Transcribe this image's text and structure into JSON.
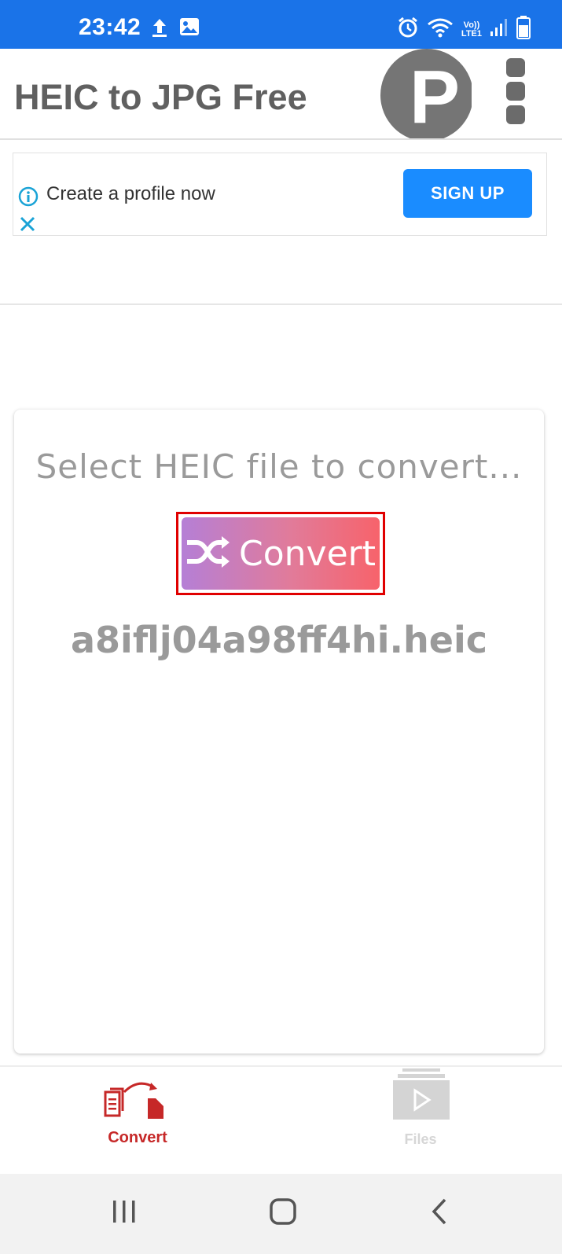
{
  "status_bar": {
    "time": "23:42",
    "left_icons": [
      "upload-icon",
      "image-icon"
    ],
    "right_icons": [
      "alarm-icon",
      "wifi-icon",
      "volte-icon",
      "signal-icon",
      "battery-icon"
    ],
    "network_label_top": "Vo))",
    "network_label_bottom": "LTE1",
    "background": "#1a73e8"
  },
  "app_bar": {
    "title": "HEIC to JPG Free",
    "profile_initial": "P",
    "menu_icon": "more-vert-icon"
  },
  "ad_banner": {
    "text": "Create a profile now",
    "button_label": "SIGN UP",
    "button_color": "#1a8cff"
  },
  "card": {
    "prompt": "Select HEIC file to convert...",
    "convert_label": "Convert",
    "convert_icon": "shuffle-icon",
    "file_name": "a8iflj04a98ff4hi.heic",
    "highlight_color": "#e00000"
  },
  "bottom_nav": {
    "items": [
      {
        "label": "Convert",
        "icon": "convert-files-icon",
        "active": true,
        "color": "#c62828"
      },
      {
        "label": "Files",
        "icon": "files-play-icon",
        "active": false,
        "color": "#d0d0d0"
      }
    ]
  },
  "system_nav": {
    "buttons": [
      "recent-apps-icon",
      "home-icon",
      "back-icon"
    ]
  }
}
